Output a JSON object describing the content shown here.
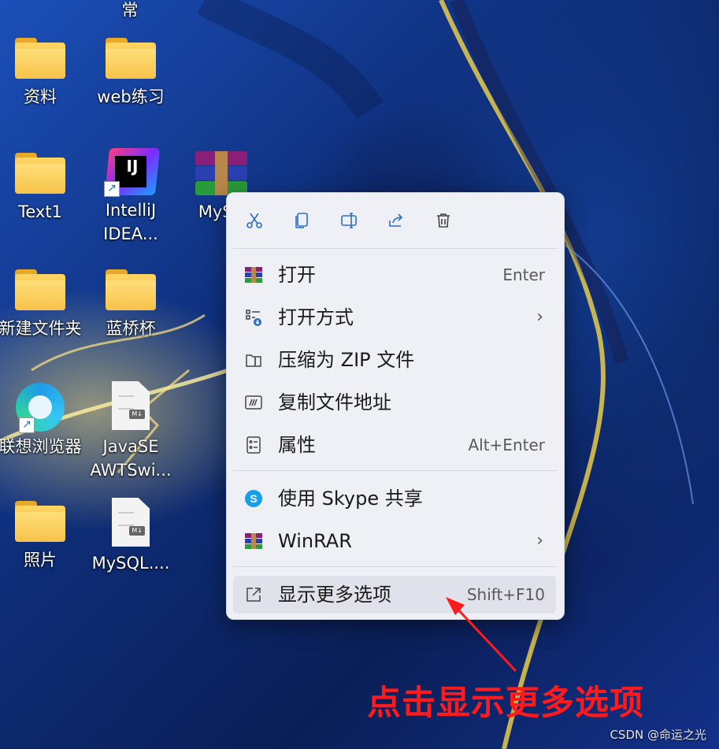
{
  "desktop": {
    "top_partial_label": "常",
    "icons": [
      {
        "label": "资料",
        "type": "folder"
      },
      {
        "label": "web练习",
        "type": "folder"
      },
      {
        "label": "Text1",
        "type": "folder"
      },
      {
        "label": "IntelliJ\nIDEA...",
        "type": "intellij-shortcut"
      },
      {
        "label": "MySC",
        "type": "winrar-archive"
      },
      {
        "label": "新建文件夹",
        "type": "folder"
      },
      {
        "label": "蓝桥杯",
        "type": "folder"
      },
      {
        "label": "联想浏览器",
        "type": "edge-shortcut"
      },
      {
        "label": "JavaSE\nAWTSwi...",
        "type": "md-file"
      },
      {
        "label": "照片",
        "type": "folder"
      },
      {
        "label": "MySQL....",
        "type": "md-file"
      }
    ],
    "md_badge": "M↓",
    "intellij_badge": "IJ"
  },
  "context_menu": {
    "toolbar": [
      {
        "name": "cut-icon"
      },
      {
        "name": "copy-icon"
      },
      {
        "name": "rename-icon"
      },
      {
        "name": "share-icon"
      },
      {
        "name": "delete-icon"
      }
    ],
    "items": [
      {
        "label": "打开",
        "shortcut": "Enter",
        "icon": "winrar-icon"
      },
      {
        "label": "打开方式",
        "submenu": true,
        "icon": "open-with-icon"
      },
      {
        "label": "压缩为 ZIP 文件",
        "icon": "zip-folder-icon"
      },
      {
        "label": "复制文件地址",
        "icon": "copy-path-icon"
      },
      {
        "label": "属性",
        "shortcut": "Alt+Enter",
        "icon": "properties-icon"
      },
      {
        "label": "使用 Skype 共享",
        "icon": "skype-icon"
      },
      {
        "label": "WinRAR",
        "submenu": true,
        "icon": "winrar-icon"
      },
      {
        "label": "显示更多选项",
        "shortcut": "Shift+F10",
        "icon": "show-more-icon",
        "highlighted": true
      }
    ],
    "chevron": "›"
  },
  "annotation": {
    "text": "点击显示更多选项",
    "color": "#ff1b1b"
  },
  "watermark": "CSDN @命运之光"
}
